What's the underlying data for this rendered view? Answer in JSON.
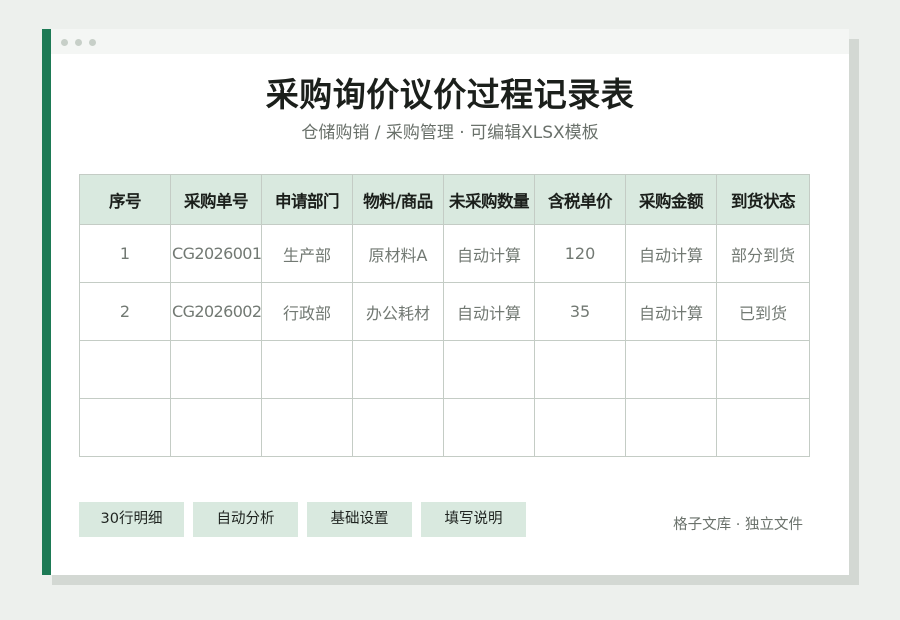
{
  "document": {
    "title": "采购询价议价过程记录表",
    "subtitle": "仓储购销 / 采购管理 · 可编辑XLSX模板"
  },
  "table": {
    "headers": [
      "序号",
      "采购单号",
      "申请部门",
      "物料/商品",
      "未采购数量",
      "含税单价",
      "采购金额",
      "到货状态"
    ],
    "rows": [
      [
        "1",
        "CG2026001",
        "生产部",
        "原材料A",
        "自动计算",
        "120",
        "自动计算",
        "部分到货"
      ],
      [
        "2",
        "CG2026002",
        "行政部",
        "办公耗材",
        "自动计算",
        "35",
        "自动计算",
        "已到货"
      ],
      [
        "",
        "",
        "",
        "",
        "",
        "",
        "",
        ""
      ],
      [
        "",
        "",
        "",
        "",
        "",
        "",
        "",
        ""
      ]
    ]
  },
  "actions": {
    "detail_label": "30行明细",
    "analysis_label": "自动分析",
    "settings_label": "基础设置",
    "instructions_label": "填写说明"
  },
  "footer": {
    "note": "格子文库 · 独立文件"
  },
  "colors": {
    "accent": "#1d7a55",
    "header_fill": "#d9e9df",
    "background": "#edf0ed"
  }
}
